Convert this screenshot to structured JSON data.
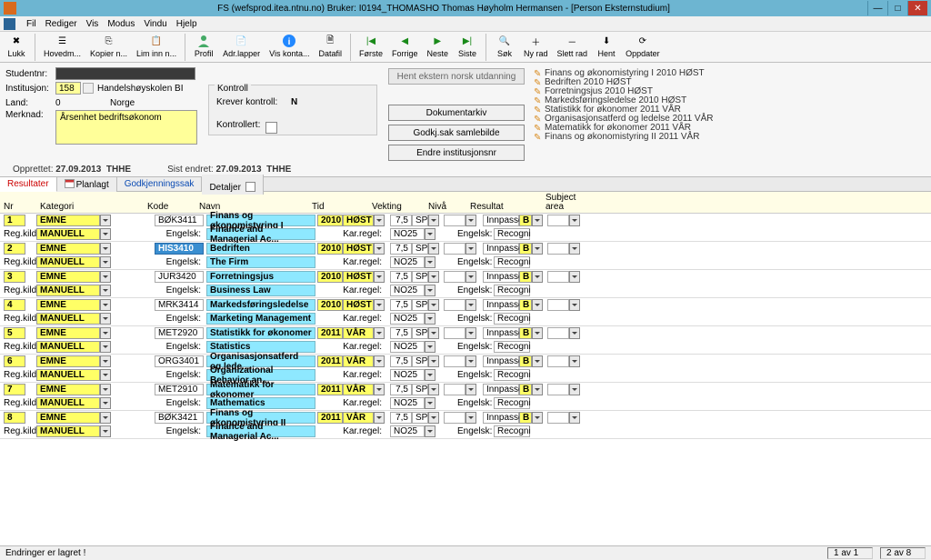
{
  "title": "FS (wefsprod.itea.ntnu.no) Bruker: I0194_THOMASHO Thomas Høyholm Hermansen - [Person Eksternstudium]",
  "menu": [
    "Fil",
    "Rediger",
    "Vis",
    "Modus",
    "Vindu",
    "Hjelp"
  ],
  "toolbar": {
    "lukk": "Lukk",
    "hovedm": "Hovedm...",
    "kopier": "Kopier n...",
    "liminn": "Lim inn n...",
    "profil": "Profil",
    "adrlapper": "Adr.lapper",
    "viskonta": "Vis konta...",
    "datafil": "Datafil",
    "forste": "Første",
    "forrige": "Forrige",
    "neste": "Neste",
    "siste": "Siste",
    "sok": "Søk",
    "nyrad": "Ny rad",
    "slettrad": "Slett rad",
    "hent": "Hent",
    "oppdater": "Oppdater"
  },
  "form": {
    "studentnr": "Studentnr:",
    "institusjon": "Institusjon:",
    "inst_code": "158",
    "inst_name": "Handelshøyskolen BI",
    "land": "Land:",
    "land_code": "0",
    "land_name": "Norge",
    "merknad": "Merknad:",
    "merknad_text": "Årsenhet bedriftsøkonom",
    "kontroll_title": "Kontroll",
    "krever": "Krever kontroll:",
    "krever_val": "N",
    "kontrollert": "Kontrollert:",
    "opprettet_lbl": "Opprettet:",
    "opprettet_val": "27.09.2013",
    "opprettet_by": "THHE",
    "sist_endret_lbl": "Sist endret:",
    "sist_endret_val": "27.09.2013",
    "sist_endret_by": "THHE"
  },
  "buttons": {
    "hent_ext": "Hent ekstern norsk utdanning",
    "dokument": "Dokumentarkiv",
    "godkj": "Godkj.sak samlebilde",
    "endre": "Endre institusjonsnr"
  },
  "right_list": [
    "Finans og økonomistyring I 2010 HØST",
    "Bedriften 2010 HØST",
    "Forretningsjus 2010 HØST",
    "Markedsføringsledelse 2010 HØST",
    "Statistikk for økonomer 2011 VÅR",
    "Organisasjonsatferd og ledelse 2011 VÅR",
    "Matematikk for økonomer 2011 VÅR",
    "Finans og økonomistyring II 2011 VÅR"
  ],
  "tabs": {
    "resultater": "Resultater",
    "planlagt": "Planlagt",
    "godkj": "Godkjenningssak",
    "detaljer": "Detaljer"
  },
  "headers": {
    "nr": "Nr",
    "kategori": "Kategori",
    "kode": "Kode",
    "navn": "Navn",
    "tid": "Tid",
    "vekting": "Vekting",
    "niva": "Nivå",
    "resultat": "Resultat",
    "subject": "Subject",
    "area": "area"
  },
  "labels": {
    "regkilde": "Reg.kilde:",
    "engelsk": "Engelsk:",
    "karregel": "Kar.regel:",
    "engelsk2": "Engelsk:"
  },
  "rows": [
    {
      "nr": "1",
      "kat": "EMNE",
      "manuell": "MANUELL",
      "kode": "BØK3411",
      "navn": "Finans og økonomistyring I",
      "en": "Finance and Managerial Ac...",
      "y": "2010",
      "s": "HØST",
      "vn": "7,5",
      "vt": "SP",
      "res": "Innpasse",
      "resb": "B",
      "kar": "NO25",
      "eng": "Recogni"
    },
    {
      "nr": "2",
      "kat": "EMNE",
      "manuell": "MANUELL",
      "kode": "HIS3410",
      "navn": "Bedriften",
      "en": "The Firm",
      "y": "2010",
      "s": "HØST",
      "vn": "7,5",
      "vt": "SP",
      "res": "Innpasse",
      "resb": "B",
      "kar": "NO25",
      "eng": "Recogni",
      "highlight_kode": true
    },
    {
      "nr": "3",
      "kat": "EMNE",
      "manuell": "MANUELL",
      "kode": "JUR3420",
      "navn": "Forretningsjus",
      "en": "Business Law",
      "y": "2010",
      "s": "HØST",
      "vn": "7,5",
      "vt": "SP",
      "res": "Innpasse",
      "resb": "B",
      "kar": "NO25",
      "eng": "Recogni"
    },
    {
      "nr": "4",
      "kat": "EMNE",
      "manuell": "MANUELL",
      "kode": "MRK3414",
      "navn": "Markedsføringsledelse",
      "en": "Marketing Management",
      "y": "2010",
      "s": "HØST",
      "vn": "7,5",
      "vt": "SP",
      "res": "Innpasse",
      "resb": "B",
      "kar": "NO25",
      "eng": "Recogni"
    },
    {
      "nr": "5",
      "kat": "EMNE",
      "manuell": "MANUELL",
      "kode": "MET2920",
      "navn": "Statistikk for økonomer",
      "en": "Statistics",
      "y": "2011",
      "s": "VÅR",
      "vn": "7,5",
      "vt": "SP",
      "res": "Innpasse",
      "resb": "B",
      "kar": "NO25",
      "eng": "Recogni"
    },
    {
      "nr": "6",
      "kat": "EMNE",
      "manuell": "MANUELL",
      "kode": "ORG3401",
      "navn": "Organisasjonsatferd og lede...",
      "en": "Organizational Behavior an...",
      "y": "2011",
      "s": "VÅR",
      "vn": "7,5",
      "vt": "SP",
      "res": "Innpasse",
      "resb": "B",
      "kar": "NO25",
      "eng": "Recogni"
    },
    {
      "nr": "7",
      "kat": "EMNE",
      "manuell": "MANUELL",
      "kode": "MET2910",
      "navn": "Matematikk for økonomer",
      "en": "Mathematics",
      "y": "2011",
      "s": "VÅR",
      "vn": "7,5",
      "vt": "SP",
      "res": "Innpasse",
      "resb": "B",
      "kar": "NO25",
      "eng": "Recogni"
    },
    {
      "nr": "8",
      "kat": "EMNE",
      "manuell": "MANUELL",
      "kode": "BØK3421",
      "navn": "Finans og økonomistyring II",
      "en": "Finance and Managerial Ac...",
      "y": "2011",
      "s": "VÅR",
      "vn": "7,5",
      "vt": "SP",
      "res": "Innpasse",
      "resb": "B",
      "kar": "NO25",
      "eng": "Recogni"
    }
  ],
  "status": {
    "left": "Endringer er lagret !",
    "r1": "1 av 1",
    "r2": "2 av 8"
  }
}
